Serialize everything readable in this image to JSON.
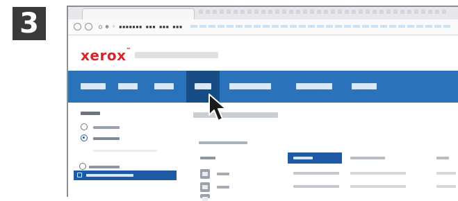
{
  "step": {
    "number": "3"
  },
  "browser": {
    "url": "○ ⊕ ◦ ▪▪▪▪▪▪▪ ▪▪▪ ▪▪▪ ▪▪▪"
  },
  "brand": {
    "logo": "xerox",
    "trademark": "™"
  },
  "colors": {
    "navbar": "#2a73ba",
    "navbar_active": "#174d85",
    "accent": "#1e5aa6",
    "logo": "#d4262b"
  },
  "icons": {
    "cursor": "arrow-cursor-icon",
    "printer": "printer-icon",
    "radio": "radio-icon"
  },
  "navbar": {
    "items": 7,
    "active_index": 3
  },
  "left_panel": {
    "radio_options": 3,
    "selected_option": 1
  },
  "table": {
    "rows": 2,
    "sorted_column": 1
  }
}
